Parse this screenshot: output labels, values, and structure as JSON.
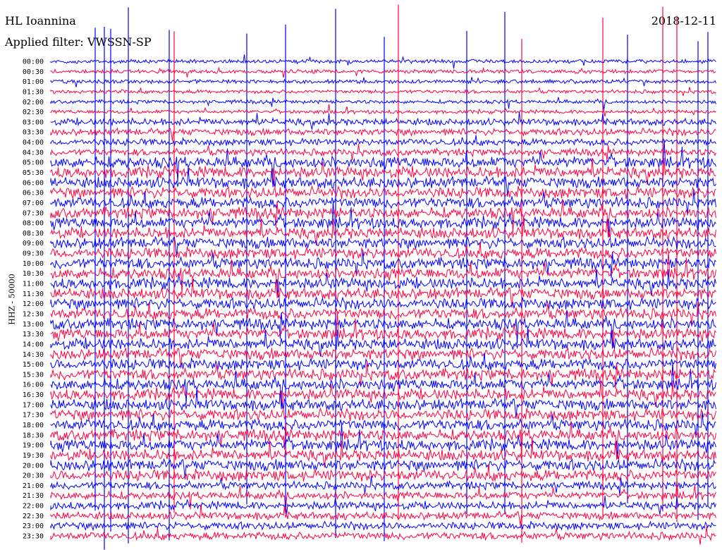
{
  "header": {
    "station": "HL Ioannina",
    "filter": "Applied filter: VWSSN-SP",
    "date": "2018-12-11",
    "channel_label": "HHZ - 50000"
  },
  "colors": {
    "trace_a": "#0000ff",
    "trace_b": "#ff0040"
  },
  "chart_data": {
    "type": "line",
    "title": "HL Ioannina",
    "ylabel": "HHZ - 50000",
    "row_labels": [
      "00:00",
      "00:30",
      "01:00",
      "01:30",
      "02:00",
      "02:30",
      "03:00",
      "03:30",
      "04:00",
      "04:30",
      "05:00",
      "05:30",
      "06:00",
      "06:30",
      "07:00",
      "07:30",
      "08:00",
      "08:30",
      "09:00",
      "09:30",
      "10:00",
      "10:30",
      "11:00",
      "11:30",
      "12:00",
      "12:30",
      "13:00",
      "13:30",
      "14:00",
      "14:30",
      "15:00",
      "15:30",
      "16:00",
      "16:30",
      "17:00",
      "17:30",
      "18:00",
      "18:30",
      "19:00",
      "19:30",
      "20:00",
      "20:30",
      "21:00",
      "21:30",
      "22:00",
      "22:30",
      "23:00",
      "23:30"
    ],
    "row_colors": "alternating blue/red starting with blue",
    "minutes_per_row": 30
  }
}
